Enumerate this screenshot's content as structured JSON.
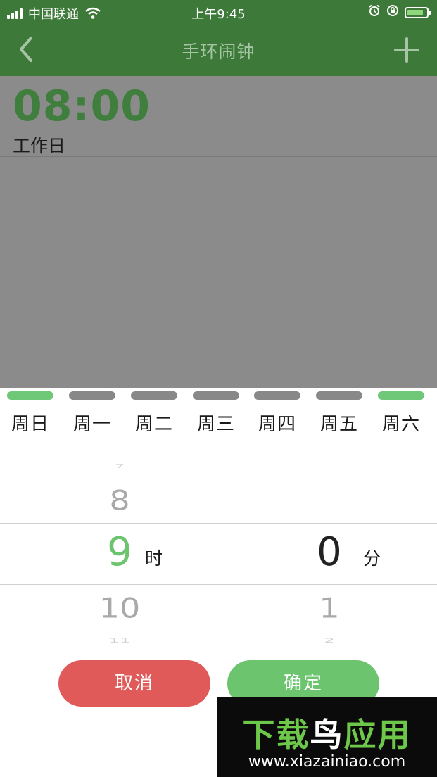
{
  "status_bar": {
    "carrier": "中国联通",
    "time": "上午9:45"
  },
  "nav": {
    "title": "手环闹钟",
    "add_icon": "plus-icon",
    "back_icon": "chevron-left-icon"
  },
  "alarm": {
    "time": "08:00",
    "repeat": "工作日"
  },
  "weekdays": [
    {
      "label": "周日",
      "selected": true
    },
    {
      "label": "周一",
      "selected": false
    },
    {
      "label": "周二",
      "selected": false
    },
    {
      "label": "周三",
      "selected": false
    },
    {
      "label": "周四",
      "selected": false
    },
    {
      "label": "周五",
      "selected": false
    },
    {
      "label": "周六",
      "selected": true
    }
  ],
  "picker": {
    "hour": {
      "above2": "7",
      "above1": "8",
      "selected": "9",
      "below1": "10",
      "below2": "11",
      "unit": "时"
    },
    "minute": {
      "selected": "0",
      "below1": "1",
      "below2": "2",
      "unit": "分"
    }
  },
  "buttons": {
    "cancel": "取消",
    "confirm": "确定"
  },
  "watermark": {
    "title_green_1": "下载",
    "title_white": "鸟",
    "title_green_2": "应用",
    "url": "www.xiazainiao.com"
  },
  "colors": {
    "brand_green": "#3d7a3a",
    "day_selected": "#6fc877",
    "day_unselected": "#888888",
    "cancel": "#e05a5a",
    "confirm": "#6cc46f"
  }
}
